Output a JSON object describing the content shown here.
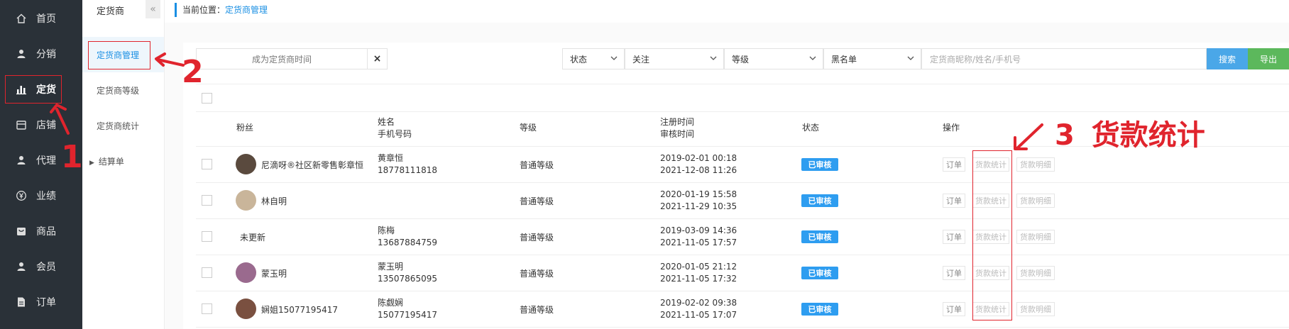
{
  "nav": {
    "items": [
      {
        "label": "首页",
        "icon": "home-icon"
      },
      {
        "label": "分销",
        "icon": "user-icon"
      },
      {
        "label": "定货",
        "icon": "bar-chart-icon"
      },
      {
        "label": "店铺",
        "icon": "store-icon"
      },
      {
        "label": "代理",
        "icon": "user-icon"
      },
      {
        "label": "业绩",
        "icon": "yen-icon"
      },
      {
        "label": "商品",
        "icon": "box-icon"
      },
      {
        "label": "会员",
        "icon": "user-icon"
      },
      {
        "label": "订单",
        "icon": "document-icon"
      }
    ],
    "active_index": 2
  },
  "subnav": {
    "title": "定货商",
    "collapse_icon": "«",
    "items": [
      {
        "label": "定货商管理"
      },
      {
        "label": "定货商等级"
      },
      {
        "label": "定货商统计"
      },
      {
        "label": "结算单"
      }
    ],
    "active_index": 0
  },
  "breadcrumb": {
    "prefix": "当前位置：",
    "current": "定货商管理"
  },
  "filters": {
    "date_placeholder": "成为定货商时间",
    "clear_icon": "×",
    "status": "状态",
    "follow": "关注",
    "level": "等级",
    "blacklist": "黑名单",
    "search_placeholder": "定货商昵称/姓名/手机号",
    "search_label": "搜索",
    "export_label": "导出"
  },
  "table": {
    "headers": {
      "fans": "粉丝",
      "name": "姓名",
      "phone": "手机号码",
      "level": "等级",
      "reg_time": "注册时间",
      "audit_time": "审核时间",
      "status": "状态",
      "ops": "操作"
    },
    "rows": [
      {
        "fan": "尼滴呀®社区新零售彰章恒",
        "name": "黄章恒",
        "phone": "18778111818",
        "level": "普通等级",
        "reg": "2019-02-01 00:18",
        "audit": "2021-12-08 11:26",
        "status": "已审核",
        "avatar": true
      },
      {
        "fan": "林自明",
        "name": "",
        "phone": "",
        "level": "普通等级",
        "reg": "2020-01-19 15:58",
        "audit": "2021-11-29 10:35",
        "status": "已审核",
        "avatar": true
      },
      {
        "fan": "未更新",
        "name": "陈梅",
        "phone": "13687884759",
        "level": "普通等级",
        "reg": "2019-03-09 14:36",
        "audit": "2021-11-05 17:57",
        "status": "已审核",
        "avatar": false
      },
      {
        "fan": "蒙玉明",
        "name": "蒙玉明",
        "phone": "13507865095",
        "level": "普通等级",
        "reg": "2020-01-05 21:12",
        "audit": "2021-11-05 17:32",
        "status": "已审核",
        "avatar": true
      },
      {
        "fan": "娴姐15077195417",
        "name": "陈觑娴",
        "phone": "15077195417",
        "level": "普通等级",
        "reg": "2019-02-02 09:38",
        "audit": "2021-11-05 17:07",
        "status": "已审核",
        "avatar": true
      }
    ],
    "ops": {
      "order": "订单",
      "payment_stats": "货款统计",
      "payment_detail": "货款明细"
    }
  },
  "annotations": {
    "step1": "1",
    "step2": "2",
    "step3_num": "3",
    "step3_text": "货款统计",
    "color": "#e0242d"
  }
}
